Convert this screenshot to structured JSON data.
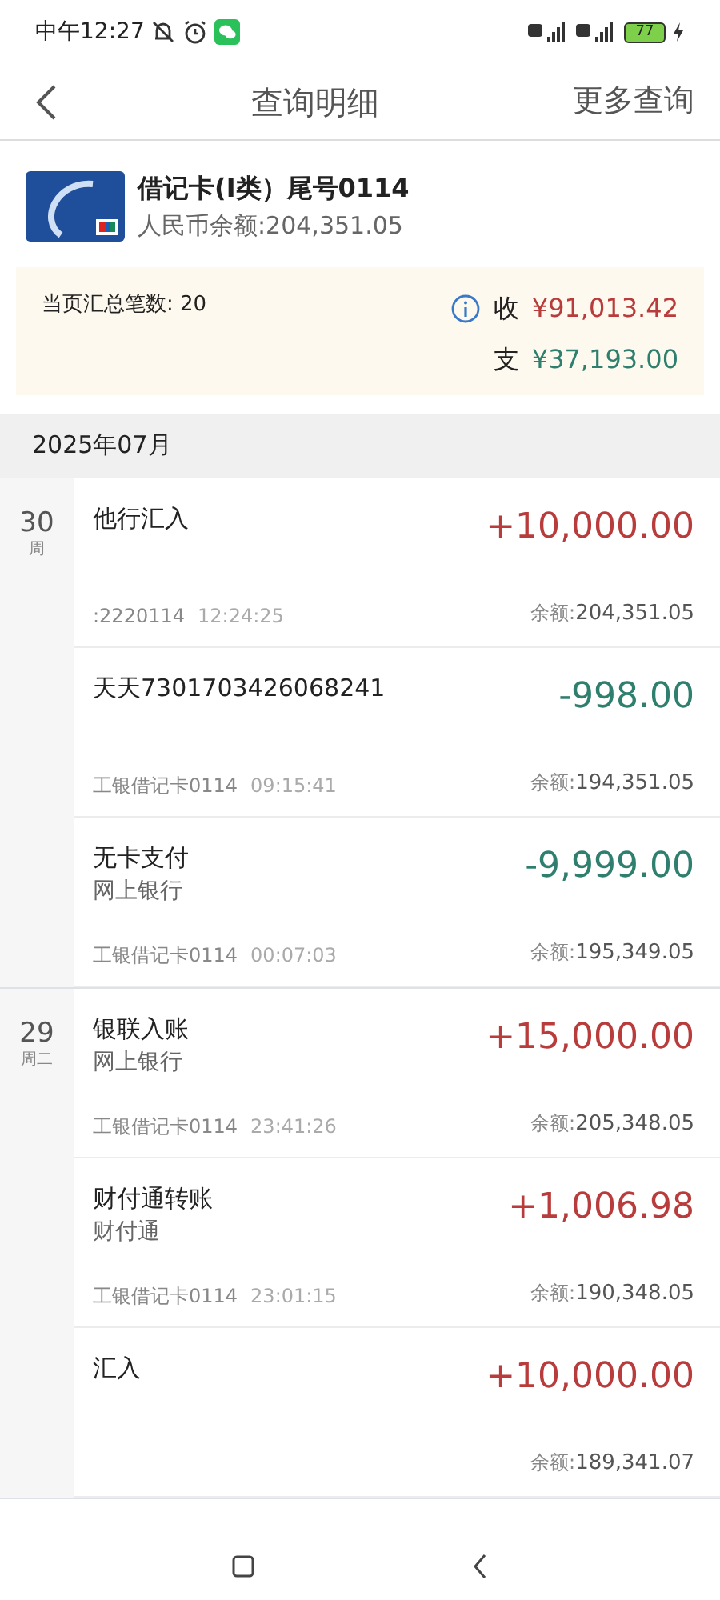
{
  "status_bar": {
    "time": "中午12:27",
    "battery": "77"
  },
  "header": {
    "title": "查询明细",
    "action": "更多查询"
  },
  "account": {
    "name": "借记卡(Ⅰ类）尾号0114",
    "balance": "人民币余额:204,351.05"
  },
  "summary": {
    "count": "当页汇总笔数: 20",
    "income_label": "收",
    "income": "¥91,013.42",
    "expense_label": "支",
    "expense": "¥37,193.00"
  },
  "month": "2025年07月",
  "days": [
    {
      "day": "30",
      "weekday": "周",
      "transactions": [
        {
          "title": "他行汇入",
          "card": ":2220114",
          "time": "12:24:25",
          "amount": "+10,000.00",
          "kind": "credit",
          "balance_label": "余额:",
          "balance": "204,351.05"
        },
        {
          "title": "天天7301703426068241",
          "card": "工银借记卡0114",
          "time": "09:15:41",
          "amount": "-998.00",
          "kind": "debit",
          "balance_label": "余额:",
          "balance": "194,351.05"
        },
        {
          "title": "无卡支付",
          "channel": "网上银行",
          "card": "工银借记卡0114",
          "time": "00:07:03",
          "amount": "-9,999.00",
          "kind": "debit",
          "balance_label": "余额:",
          "balance": "195,349.05"
        }
      ]
    },
    {
      "day": "29",
      "weekday": "周二",
      "transactions": [
        {
          "title": "银联入账",
          "channel": "网上银行",
          "card": "工银借记卡0114",
          "time": "23:41:26",
          "amount": "+15,000.00",
          "kind": "credit",
          "balance_label": "余额:",
          "balance": "205,348.05"
        },
        {
          "title": "财付通转账",
          "channel": "财付通",
          "card": "工银借记卡0114",
          "time": "23:01:15",
          "amount": "+1,006.98",
          "kind": "credit",
          "balance_label": "余额:",
          "balance": "190,348.05"
        },
        {
          "title": "汇入",
          "amount": "+10,000.00",
          "kind": "credit",
          "balance_label": "余额:",
          "balance": "189,341.07"
        }
      ]
    }
  ]
}
